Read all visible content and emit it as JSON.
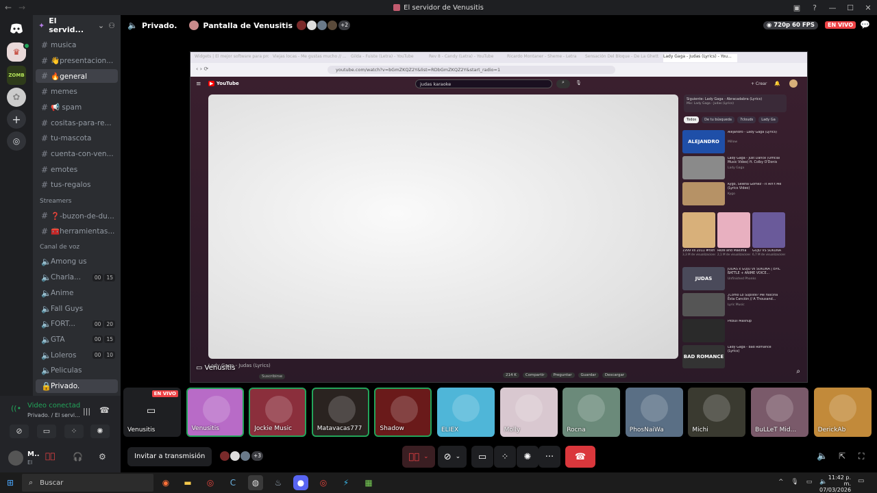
{
  "window": {
    "title": "El servidor de Venusitis"
  },
  "server": {
    "name": "El servid..."
  },
  "channels": {
    "text": [
      "musica",
      "👋presentacion...",
      "🔥general",
      "memes",
      "📢 spam",
      "cositas-para-re...",
      "tu-mascota",
      "cuenta-con-ven...",
      "emotes",
      "tus-regalos"
    ],
    "streamers_cat": "Streamers",
    "streamers": [
      "❓-buzon-de-du...",
      "🧰herramientas..."
    ],
    "voice_cat": "Canal de voz",
    "voice": [
      {
        "name": "Among us",
        "counts": []
      },
      {
        "name": "Charla...",
        "counts": [
          "00",
          "15"
        ]
      },
      {
        "name": "Anime",
        "counts": []
      },
      {
        "name": "Fall Guys",
        "counts": []
      },
      {
        "name": "FORT...",
        "counts": [
          "00",
          "20"
        ]
      },
      {
        "name": "GTA",
        "counts": [
          "00",
          "15"
        ]
      },
      {
        "name": "Loleros",
        "counts": [
          "00",
          "10"
        ]
      },
      {
        "name": "Peliculas",
        "counts": []
      },
      {
        "name": "Privado.",
        "counts": []
      }
    ]
  },
  "voicepanel": {
    "status": "Video conectad",
    "sub": "Privado. / El servi...",
    "user": "M..",
    "user_sub": "El"
  },
  "topbar": {
    "channel": "Privado.",
    "stream_title": "Pantalla de Venusitis",
    "extra_count": "+2",
    "quality": "720p 60 FPS",
    "live": "EN VIVO"
  },
  "browser": {
    "tabs": [
      "Widgets | El mejor software para pro...",
      "Viejas locas - Me gustas mucho // ...",
      "Gilda - Fuiste (Letra) - YouTube",
      "Rev 8 - Candy (Letra) - YouTube",
      "Ricardo Montaner - Sheme - Letra",
      "Sensación Del Bloque - De La Ghett...",
      "Lady Gaga - Judas (Lyrics) - You..."
    ],
    "url": "youtube.com/watch?v=bGmZKQZ2Y&list=RDbGmZKQZ2Y&start_radio=1",
    "search": "judas karaoke",
    "create": "+ Crear",
    "next_title": "Siguiente: Lady Gaga - Abracadabra (Lyrics)",
    "next_sub": "Mix: Lady Gaga - Judas (Lyrics)",
    "chips": [
      "Todos",
      "De tu búsqueda",
      "7clouds",
      "Lady Ga"
    ],
    "video_title": "Lady Gaga - Judas (Lyrics)",
    "subscribe": "Suscribirse",
    "likes": "214 K",
    "actions": [
      "Compartir",
      "Preguntar",
      "Guardar",
      "Descargar"
    ],
    "related": [
      {
        "t": "Alejandro - Lady Gaga (Lyrics)",
        "s": "Millow"
      },
      {
        "t": "Lady Gaga - Just Dance (Official Music Video) ft. Colby O'Donis",
        "s": "Lady Gaga"
      },
      {
        "t": "Kygo, Selena Gomez - It Ain't Me (Lyrics Video)",
        "s": "Kygo"
      },
      {
        "t": "JUDAS x GOJO vs SUKUNA | EPIC BATTLE + ANIME VOICE...",
        "s": "Unfinished Phonks"
      },
      {
        "t": "¿Cómo Lo Supiste? Me Fascina Esta Canción // A Thousand...",
        "s": "Lyric Music"
      },
      {
        "t": "Pitbull Mashup",
        "s": ""
      },
      {
        "t": "Lady Gaga - Bad Romance (Lyrics)",
        "s": ""
      }
    ],
    "shorts": [
      {
        "t": "1999 vs 2011 #hxh",
        "v": "3,3 M de visualizaciones"
      },
      {
        "t": "Reze and Makima",
        "v": "2,1 M de visualizaciones"
      },
      {
        "t": "GOJO VS SUKUNA",
        "v": "6,7 M de visualizaciones"
      }
    ],
    "thumb_alejandro": "ALEJANDRO",
    "thumb_judas": "JUDAS",
    "thumb_bad": "BAD ROMANCE"
  },
  "stream_label": "Venusitis",
  "tiles": [
    {
      "name": "Venusitis",
      "live": "EN VIVO",
      "color": "#1e1f22"
    },
    {
      "name": "Venusitis",
      "color": "#b86bc7"
    },
    {
      "name": "Jockie Music",
      "color": "#8b2f3c"
    },
    {
      "name": "Matavacas777",
      "color": "#2a2320"
    },
    {
      "name": "Shadow",
      "color": "#6a1a1a"
    },
    {
      "name": "ELIEX",
      "color": "#4fb6d8"
    },
    {
      "name": "Molly",
      "color": "#d9c8d0"
    },
    {
      "name": "Rocna",
      "color": "#6b8a7a"
    },
    {
      "name": "PhosNaiWa",
      "color": "#5a6f85"
    },
    {
      "name": "Michi",
      "color": "#3a3a30"
    },
    {
      "name": "BuLLeT Mid...",
      "color": "#7a5a6a"
    },
    {
      "name": "DerickAb",
      "color": "#c28a3a"
    }
  ],
  "controls": {
    "invite": "Invitar a transmisión",
    "viewers_extra": "+3"
  },
  "taskbar": {
    "search": "Buscar",
    "time": "11:42 p. m.",
    "date": "07/03/2026"
  },
  "colors": {
    "live": "#ed4245",
    "accent": "#5865f2",
    "green": "#23a55a"
  }
}
